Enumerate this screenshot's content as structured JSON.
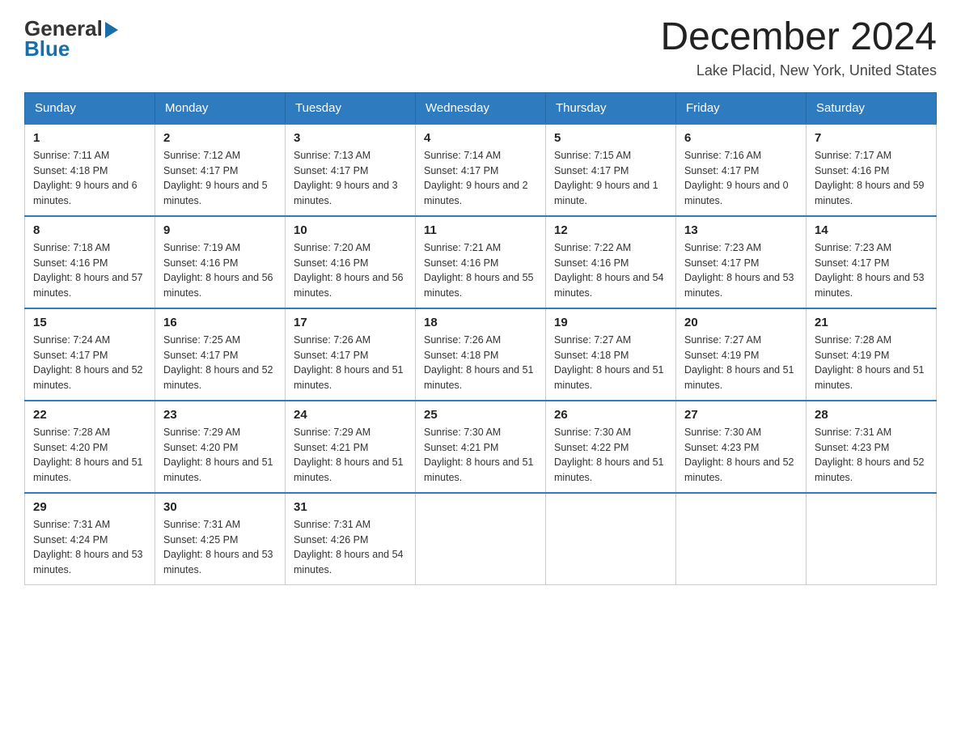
{
  "header": {
    "logo_general": "General",
    "logo_blue": "Blue",
    "month_year": "December 2024",
    "location": "Lake Placid, New York, United States"
  },
  "days_of_week": [
    "Sunday",
    "Monday",
    "Tuesday",
    "Wednesday",
    "Thursday",
    "Friday",
    "Saturday"
  ],
  "weeks": [
    [
      {
        "day": "1",
        "sunrise": "7:11 AM",
        "sunset": "4:18 PM",
        "daylight": "9 hours and 6 minutes."
      },
      {
        "day": "2",
        "sunrise": "7:12 AM",
        "sunset": "4:17 PM",
        "daylight": "9 hours and 5 minutes."
      },
      {
        "day": "3",
        "sunrise": "7:13 AM",
        "sunset": "4:17 PM",
        "daylight": "9 hours and 3 minutes."
      },
      {
        "day": "4",
        "sunrise": "7:14 AM",
        "sunset": "4:17 PM",
        "daylight": "9 hours and 2 minutes."
      },
      {
        "day": "5",
        "sunrise": "7:15 AM",
        "sunset": "4:17 PM",
        "daylight": "9 hours and 1 minute."
      },
      {
        "day": "6",
        "sunrise": "7:16 AM",
        "sunset": "4:17 PM",
        "daylight": "9 hours and 0 minutes."
      },
      {
        "day": "7",
        "sunrise": "7:17 AM",
        "sunset": "4:16 PM",
        "daylight": "8 hours and 59 minutes."
      }
    ],
    [
      {
        "day": "8",
        "sunrise": "7:18 AM",
        "sunset": "4:16 PM",
        "daylight": "8 hours and 57 minutes."
      },
      {
        "day": "9",
        "sunrise": "7:19 AM",
        "sunset": "4:16 PM",
        "daylight": "8 hours and 56 minutes."
      },
      {
        "day": "10",
        "sunrise": "7:20 AM",
        "sunset": "4:16 PM",
        "daylight": "8 hours and 56 minutes."
      },
      {
        "day": "11",
        "sunrise": "7:21 AM",
        "sunset": "4:16 PM",
        "daylight": "8 hours and 55 minutes."
      },
      {
        "day": "12",
        "sunrise": "7:22 AM",
        "sunset": "4:16 PM",
        "daylight": "8 hours and 54 minutes."
      },
      {
        "day": "13",
        "sunrise": "7:23 AM",
        "sunset": "4:17 PM",
        "daylight": "8 hours and 53 minutes."
      },
      {
        "day": "14",
        "sunrise": "7:23 AM",
        "sunset": "4:17 PM",
        "daylight": "8 hours and 53 minutes."
      }
    ],
    [
      {
        "day": "15",
        "sunrise": "7:24 AM",
        "sunset": "4:17 PM",
        "daylight": "8 hours and 52 minutes."
      },
      {
        "day": "16",
        "sunrise": "7:25 AM",
        "sunset": "4:17 PM",
        "daylight": "8 hours and 52 minutes."
      },
      {
        "day": "17",
        "sunrise": "7:26 AM",
        "sunset": "4:17 PM",
        "daylight": "8 hours and 51 minutes."
      },
      {
        "day": "18",
        "sunrise": "7:26 AM",
        "sunset": "4:18 PM",
        "daylight": "8 hours and 51 minutes."
      },
      {
        "day": "19",
        "sunrise": "7:27 AM",
        "sunset": "4:18 PM",
        "daylight": "8 hours and 51 minutes."
      },
      {
        "day": "20",
        "sunrise": "7:27 AM",
        "sunset": "4:19 PM",
        "daylight": "8 hours and 51 minutes."
      },
      {
        "day": "21",
        "sunrise": "7:28 AM",
        "sunset": "4:19 PM",
        "daylight": "8 hours and 51 minutes."
      }
    ],
    [
      {
        "day": "22",
        "sunrise": "7:28 AM",
        "sunset": "4:20 PM",
        "daylight": "8 hours and 51 minutes."
      },
      {
        "day": "23",
        "sunrise": "7:29 AM",
        "sunset": "4:20 PM",
        "daylight": "8 hours and 51 minutes."
      },
      {
        "day": "24",
        "sunrise": "7:29 AM",
        "sunset": "4:21 PM",
        "daylight": "8 hours and 51 minutes."
      },
      {
        "day": "25",
        "sunrise": "7:30 AM",
        "sunset": "4:21 PM",
        "daylight": "8 hours and 51 minutes."
      },
      {
        "day": "26",
        "sunrise": "7:30 AM",
        "sunset": "4:22 PM",
        "daylight": "8 hours and 51 minutes."
      },
      {
        "day": "27",
        "sunrise": "7:30 AM",
        "sunset": "4:23 PM",
        "daylight": "8 hours and 52 minutes."
      },
      {
        "day": "28",
        "sunrise": "7:31 AM",
        "sunset": "4:23 PM",
        "daylight": "8 hours and 52 minutes."
      }
    ],
    [
      {
        "day": "29",
        "sunrise": "7:31 AM",
        "sunset": "4:24 PM",
        "daylight": "8 hours and 53 minutes."
      },
      {
        "day": "30",
        "sunrise": "7:31 AM",
        "sunset": "4:25 PM",
        "daylight": "8 hours and 53 minutes."
      },
      {
        "day": "31",
        "sunrise": "7:31 AM",
        "sunset": "4:26 PM",
        "daylight": "8 hours and 54 minutes."
      },
      null,
      null,
      null,
      null
    ]
  ],
  "labels": {
    "sunrise": "Sunrise:",
    "sunset": "Sunset:",
    "daylight": "Daylight:"
  }
}
